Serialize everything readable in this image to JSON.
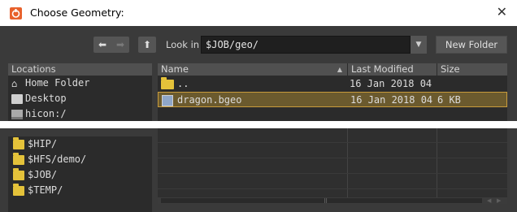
{
  "window": {
    "title": "Choose Geometry:",
    "close_glyph": "✕",
    "app_icon": "houdini-icon"
  },
  "toolbar": {
    "back_glyph": "⬅",
    "forward_glyph": "➡",
    "up_glyph": "⬆",
    "look_in_label": "Look in",
    "path_value": "$JOB/geo/",
    "dropdown_glyph": "▼",
    "new_folder_label": "New Folder"
  },
  "locations": {
    "header": "Locations",
    "items": [
      {
        "label": "Home Folder",
        "icon": "home-icon"
      },
      {
        "label": "Desktop",
        "icon": "desktop-icon"
      },
      {
        "label": "hicon:/",
        "icon": "drive-icon"
      }
    ]
  },
  "file_table": {
    "columns": [
      "Name",
      "Last Modified",
      "Size"
    ],
    "sort_glyph": "▲",
    "rows": [
      {
        "name": "..",
        "modified": "16 Jan 2018 04",
        "size": "",
        "icon": "folder-icon",
        "selected": false
      },
      {
        "name": "dragon.bgeo",
        "modified": "16 Jan 2018 04",
        "size": "6 KB",
        "icon": "geometry-file-icon",
        "selected": true
      }
    ]
  },
  "bookmarks": {
    "items": [
      {
        "label": "$HIP/",
        "icon": "folder-icon"
      },
      {
        "label": "$HFS/demo/",
        "icon": "folder-icon"
      },
      {
        "label": "$JOB/",
        "icon": "folder-icon"
      },
      {
        "label": "$TEMP/",
        "icon": "folder-icon"
      }
    ]
  },
  "scrollbar": {
    "grip_glyph": "⠿",
    "left_glyph": "◀",
    "right_glyph": "▶"
  },
  "colors": {
    "selection_bg": "#6b5a2e",
    "selection_border": "#c89b3c",
    "folder": "#e4c23a",
    "app_accent": "#e8612c"
  }
}
